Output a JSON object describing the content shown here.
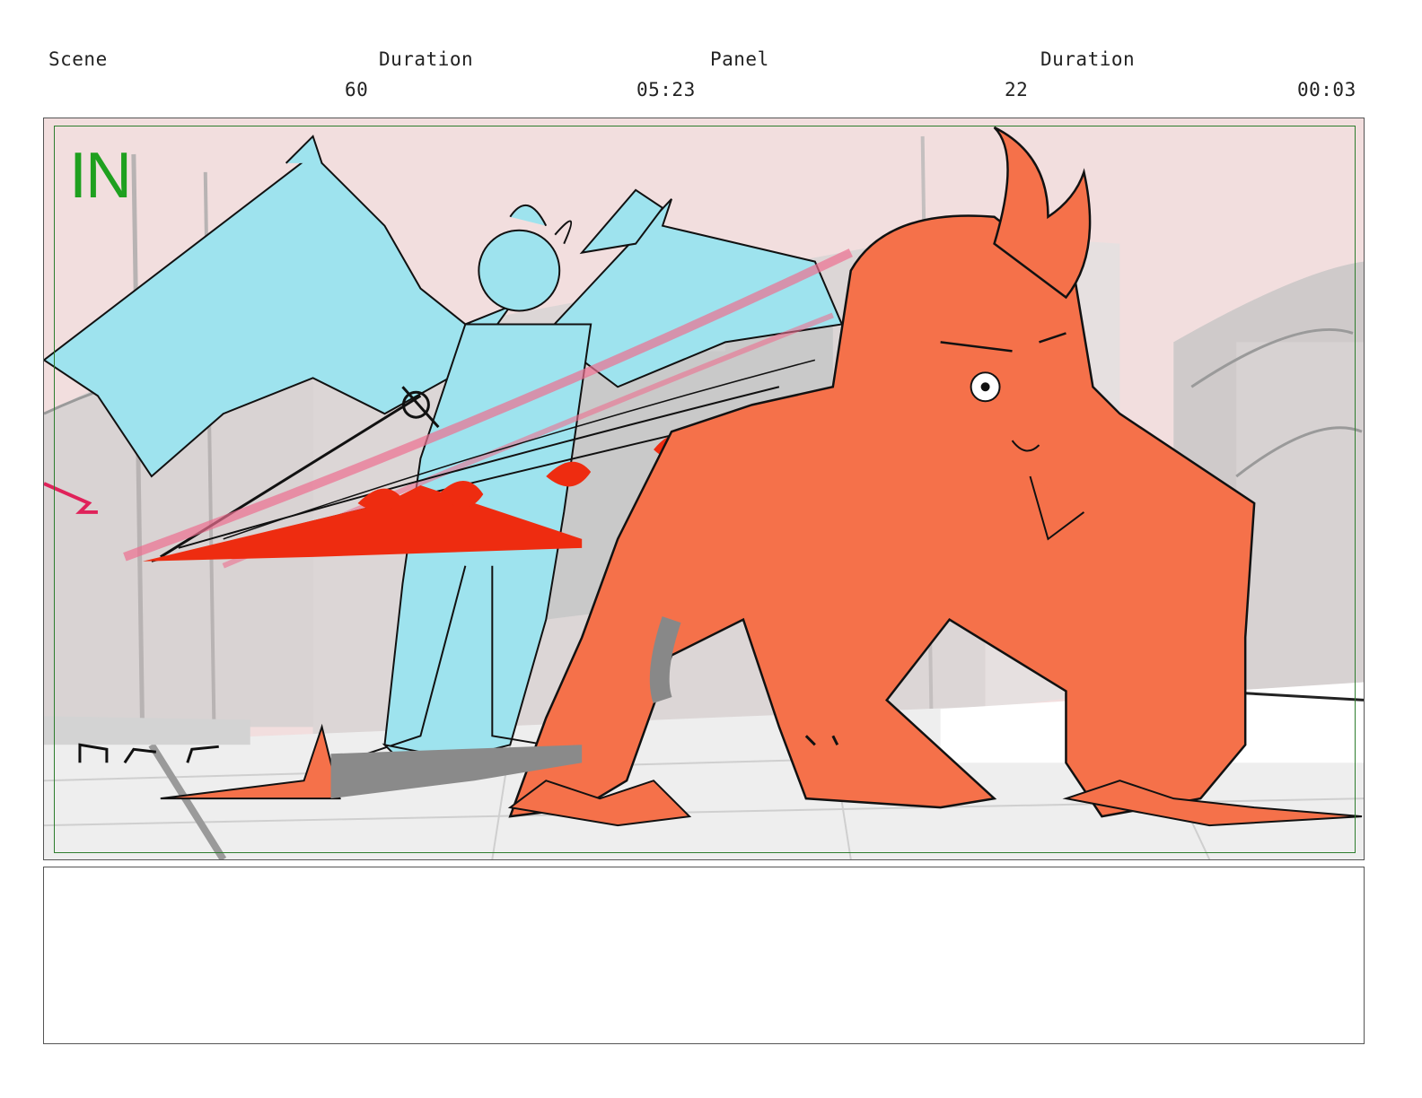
{
  "header": {
    "scene_label": "Scene",
    "scene_duration_label": "Duration",
    "panel_label": "Panel",
    "panel_duration_label": "Duration",
    "scene_number": "60",
    "scene_duration": "05:23",
    "panel_number": "22",
    "panel_duration": "00:03"
  },
  "panel": {
    "transition_label": "IN",
    "colors": {
      "sky": "#f2dede",
      "blue_character": "#9ee3ee",
      "orange_character": "#f5714a",
      "slash_red": "#ee2c10",
      "slash_pink": "#ec6f90",
      "floor": "#eeeeee",
      "safe_frame": "#2e7d2e",
      "in_label": "#1fa01f"
    }
  },
  "notes": {
    "text": ""
  }
}
